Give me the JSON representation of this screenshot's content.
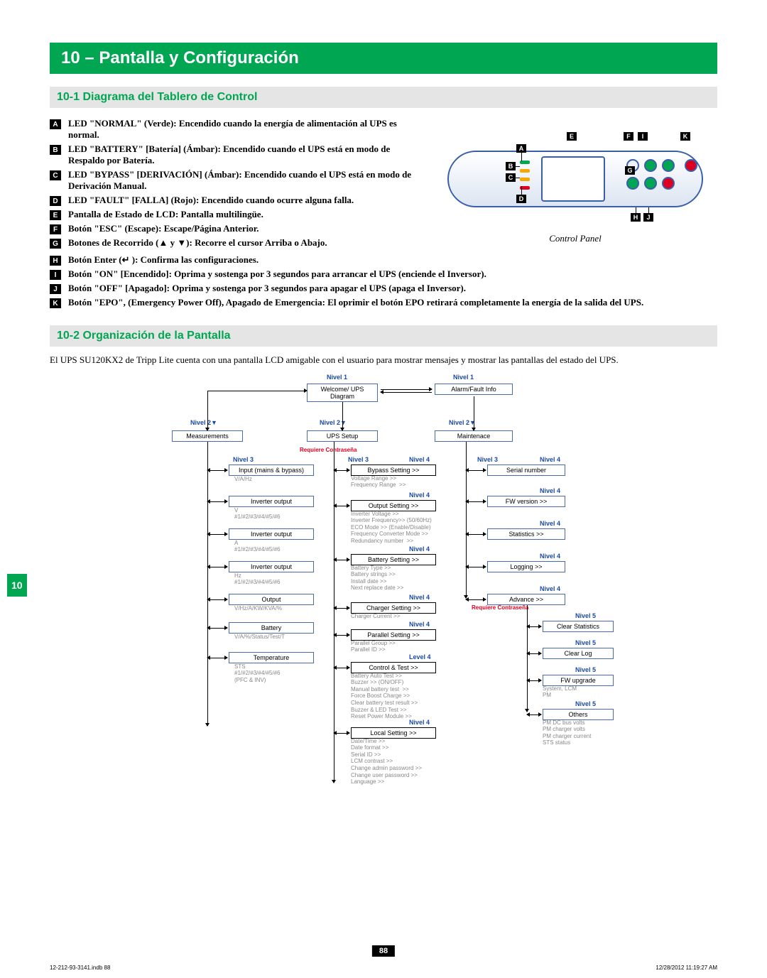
{
  "sectionHeader": "10 –  Pantalla y Configuración",
  "sub1": "10-1 Diagrama del Tablero de Control",
  "sub2": "10-2 Organización de la Pantalla",
  "panelCaption": "Control Panel",
  "sideTab": "10",
  "pageNumber": "88",
  "footerLeft": "12-212-93-3141.indb   88",
  "footerRight": "12/28/2012   11:19:27 AM",
  "items": {
    "A": "LED \"NORMAL\" (Verde): Encendido cuando la energía de alimentación al UPS es normal.",
    "B": "LED \"BATTERY\" [Batería] (Ámbar): Encendido cuando el UPS está en modo de Respaldo por Batería.",
    "C": "LED \"BYPASS\" [DERIVACIÓN] (Ámbar): Encendido cuando el UPS está en modo de Derivación Manual.",
    "D": "LED \"FAULT\" [FALLA] (Rojo): Encendido cuando ocurre alguna falla.",
    "E": "Pantalla de Estado de LCD: Pantalla multilingüe.",
    "F": "Botón \"ESC\" (Escape): Escape/Página Anterior.",
    "G": "Botones de Recorrido (▲ y ▼): Recorre el cursor Arriba o Abajo.",
    "H": "Botón Enter (↵ ): Confirma las configuraciones.",
    "I": "Botón \"ON\" [Encendido]: Oprima y sostenga por 3 segundos para arrancar el UPS (enciende el Inversor).",
    "J": "Botón \"OFF\" [Apagado]: Oprima y sostenga por 3 segundos para apagar el UPS (apaga el Inversor).",
    "K": "Botón \"EPO\", (Emergency Power Off), Apagado de Emergencia: El oprimir el botón EPO retirará completamente la energía de la salida del UPS."
  },
  "para1": "El UPS SU120KX2 de Tripp Lite cuenta con una pantalla LCD amigable con el usuario para mostrar mensajes y mostrar las pantallas del estado del UPS.",
  "flow": {
    "nivel1": "Nivel 1",
    "nivel2": "Nivel 2",
    "nivel3": "Nivel 3",
    "nivel4": "Nivel 4",
    "nivel5": "Nivel 5",
    "reqPass": "Requiere Contraseña",
    "col1": {
      "root": "Measurements",
      "n3": [
        {
          "box": "Input (mains & bypass)",
          "sub": "V/A/Hz"
        },
        {
          "box": "Inverter output",
          "sub": "V\n#1/#2/#3/#4/#5/#6"
        },
        {
          "box": "Inverter output",
          "sub": "A\n#1/#2/#3/#4/#5/#6"
        },
        {
          "box": "Inverter output",
          "sub": "Hz\n#1/#2/#3/#4/#5/#6"
        },
        {
          "box": "Output",
          "sub": "V/Hz/A/KW/KVA/%"
        },
        {
          "box": "Battery",
          "sub": "V/A/%/Status/Test/T"
        },
        {
          "box": "Temperature",
          "sub": "STS\n#1/#2/#3/#4/#5/#6\n(PFC & INV)"
        }
      ]
    },
    "col2": {
      "root1": "Welcome/\nUPS Diagram",
      "root2": "UPS Setup",
      "n4": [
        {
          "box": "Bypass Setting >>",
          "sub": "Voltage Range >>\nFrequency Range  >>"
        },
        {
          "box": "Output Setting >>",
          "sub": "Inverter Voltage >>\nInverter Frequency>> (50/60Hz)\nECO Mode >> (Enable/Disable)\nFrequency Converter Mode >>\nRedundancy number  >>"
        },
        {
          "box": "Battery Setting >>",
          "sub": "Battery Type >>\nBattery strings >>\nInstall date >>\nNext replace date >>"
        },
        {
          "box": "Charger Setting >>",
          "sub": "Charger Current >>"
        },
        {
          "box": "Parallel  Setting >>",
          "sub": "Parallel Group >>\nParallel ID >>"
        },
        {
          "box": "Control & Test >>",
          "sub": "Battery Auto Test >>\nBuzzer >> (ON/OFF)\nManual battery test  >>\nForce Boost Charge >>\nClear battery test result >>\nBuzzer & LED Test >>\nReset Power Module >>",
          "level": "Level 4"
        },
        {
          "box": "Local Setting >>",
          "sub": "Date/Time >>\nDate format >>\nSerial ID >>\nLCM contrast >>\nChange admin password >>\nChange user password >>\nLanguage >>"
        }
      ]
    },
    "col3": {
      "root1": "Alarm/Fault Info",
      "root2": "Maintenace",
      "n4": [
        {
          "box": "Serial number"
        },
        {
          "box": "FW version >>"
        },
        {
          "box": "Statistics  >>"
        },
        {
          "box": "Logging >>"
        },
        {
          "box": "Advance >>"
        }
      ],
      "n5": [
        {
          "box": "Clear Statistics"
        },
        {
          "box": "Clear Log"
        },
        {
          "box": "FW upgrade",
          "sub": "System, LCM\nPM"
        },
        {
          "box": "Others",
          "sub": "PM DC bus volts\nPM charger volts\nPM charger current\nSTS status"
        }
      ]
    }
  }
}
